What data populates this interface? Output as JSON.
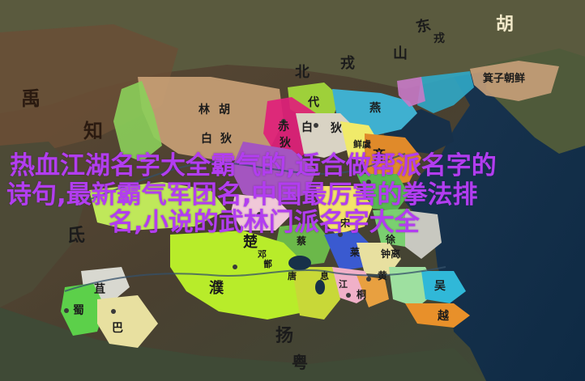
{
  "map": {
    "labels": {
      "dong": "东",
      "hu": "胡",
      "qiyuzhaoxian": "箕子朝鲜",
      "shan": "山",
      "rong": "戎",
      "bei": "北",
      "yu": "禹",
      "zhi": "知",
      "lin": "林",
      "hu2": "胡",
      "bai": "白",
      "di": "狄",
      "dai": "代",
      "yan": "燕",
      "chi": "赤",
      "bai2": "白",
      "di2": "狄",
      "xianyu": "鲜虞",
      "di3": "狄",
      "qi": "齐",
      "di4": "氐",
      "chu": "楚",
      "xu": "徐",
      "zhongli": "钟离",
      "ba": "巴",
      "shu": "蜀",
      "ju": "苴",
      "wu": "吴",
      "yue": "越",
      "yang": "扬",
      "pu": "濮",
      "yue2": "粤",
      "cai": "蔡",
      "song": "宋",
      "lai": "莱",
      "huang": "黄",
      "tong": "桐",
      "zeng": "鄫",
      "deng": "邓",
      "tang": "唐",
      "xi": "息",
      "jiang": "江"
    }
  },
  "headline": {
    "line1": "热血江湖名字大全霸气的,适合做帮派名字的",
    "line2": "诗句,最新霸气军团名,中国最厉害的拳法排",
    "line3": "名,小说的武林门派名字大全"
  }
}
